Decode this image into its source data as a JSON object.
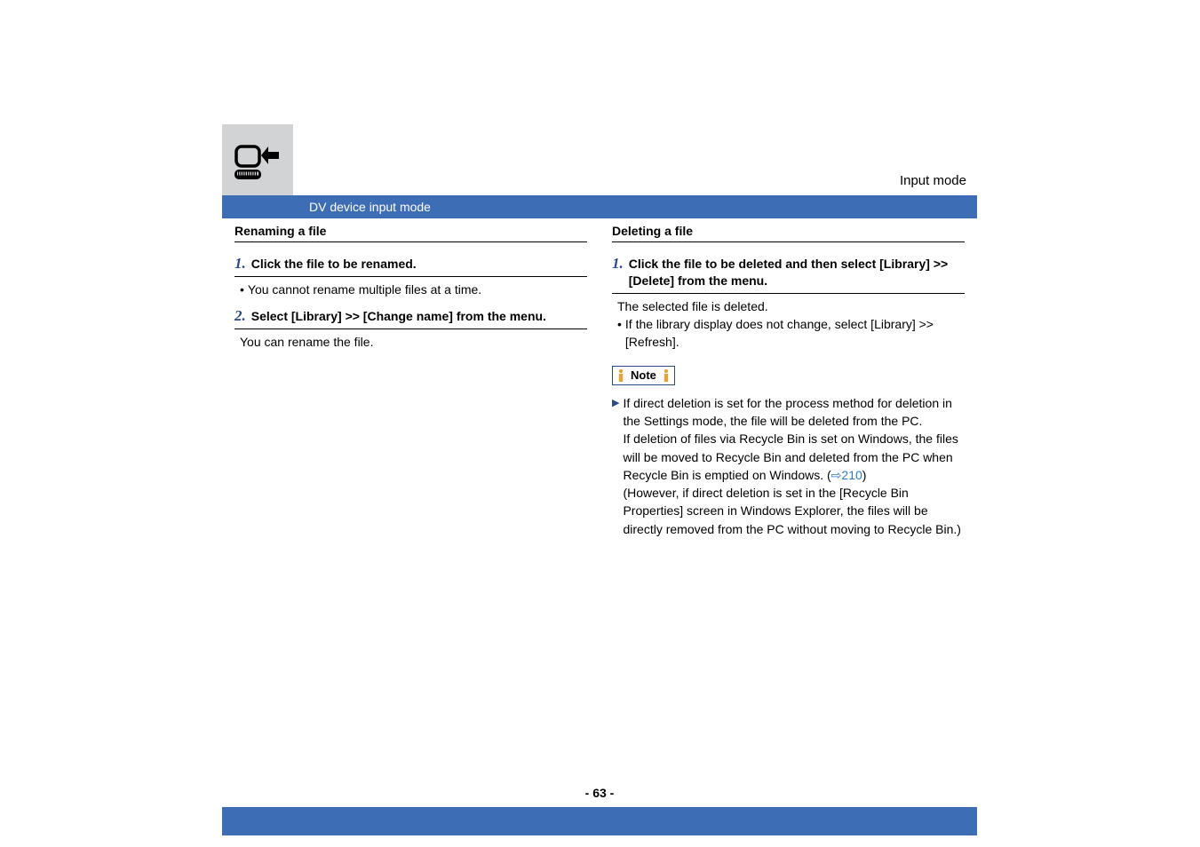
{
  "header": {
    "mode_label": "Input mode",
    "section_label": "DV device input mode"
  },
  "left_col": {
    "heading": "Renaming a file",
    "steps": [
      {
        "num": "1.",
        "title": "Click the file to be renamed.",
        "body_bullet": "You cannot rename multiple files at a time."
      },
      {
        "num": "2.",
        "title": "Select [Library] >> [Change name] from the menu.",
        "body_text": "You can rename the file."
      }
    ]
  },
  "right_col": {
    "heading": "Deleting a file",
    "steps": [
      {
        "num": "1.",
        "title": "Click the file to be deleted and then select [Library] >> [Delete] from the menu.",
        "body_text": "The selected file is deleted.",
        "body_bullet": "If the library display does not change, select [Library] >> [Refresh]."
      }
    ],
    "note_label": "Note",
    "note_text_1": "If direct deletion is set for the process method for deletion in the Settings mode, the file will be deleted from the PC.",
    "note_text_2a": "If deletion of files via Recycle Bin is set on Windows, the files will be moved to Recycle Bin and deleted from the PC when Recycle Bin is emptied on Windows. (",
    "note_link": "210",
    "note_text_2b": ")",
    "note_text_3": "(However, if direct deletion is set in the [Recycle Bin Properties] screen in Windows Explorer, the files will be directly removed from the PC without moving to Recycle Bin.)"
  },
  "page_number": "- 63 -"
}
